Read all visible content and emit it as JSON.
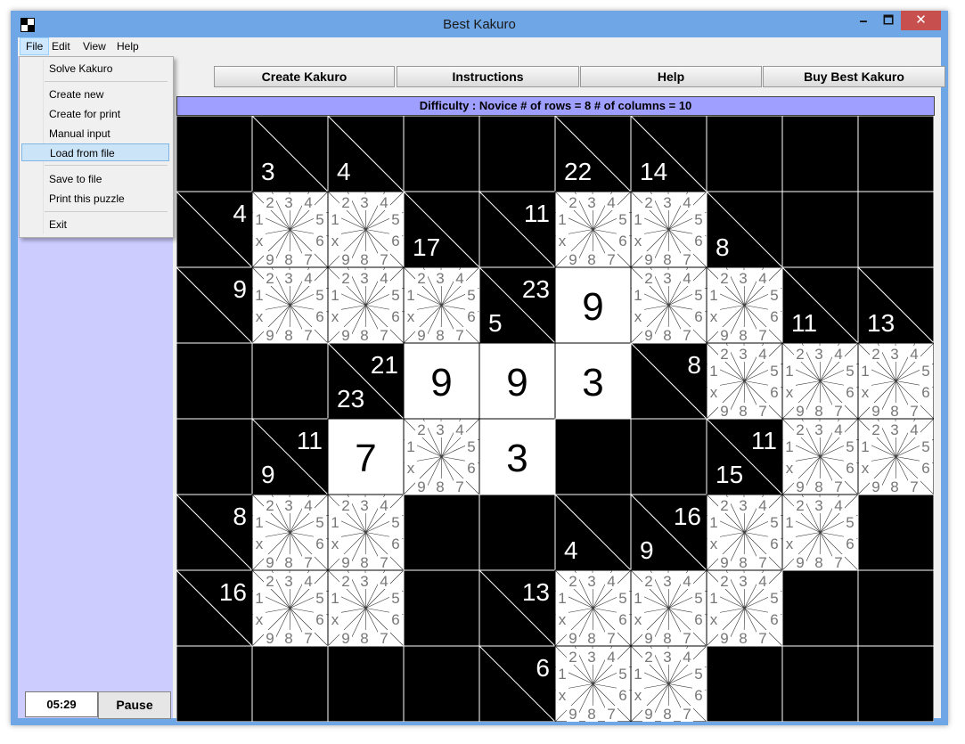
{
  "window": {
    "title": "Best Kakuro",
    "minimize": "🗕",
    "maximize": "🗖",
    "close": "✕"
  },
  "menubar": {
    "items": [
      "File",
      "Edit",
      "View",
      "Help"
    ]
  },
  "file_menu": {
    "items": [
      "Solve Kakuro",
      "Create new",
      "Create for print",
      "Manual input",
      "Load from file",
      "Save to file",
      "Print this puzzle",
      "Exit"
    ],
    "highlighted": "Load from file"
  },
  "toolbar": {
    "tabs": [
      "Create Kakuro",
      "Instructions",
      "Help",
      "Buy Best Kakuro"
    ]
  },
  "info": {
    "difficulty": "Difficulty : Novice    # of rows = 8    # of columns = 10"
  },
  "status": {
    "timer": "05:29",
    "pause_label": "Pause"
  },
  "board": {
    "rows": 8,
    "cols": 10,
    "note_digits": [
      "1",
      "2",
      "3",
      "4",
      "5",
      "6",
      "7",
      "8",
      "9",
      "x"
    ],
    "grid": [
      [
        "B",
        "C:3:",
        "C:4:",
        "B",
        "B",
        "C:22:",
        "C:14:",
        "B",
        "B",
        "B"
      ],
      [
        "C::4",
        "E",
        "E",
        "C:17:",
        "C::11",
        "E",
        "E",
        "C:8:",
        "B",
        "B"
      ],
      [
        "C::9",
        "E",
        "E",
        "E",
        "C:5:23",
        "V:9",
        "E",
        "E",
        "C:11:",
        "C:13:"
      ],
      [
        "B",
        "B",
        "C:23:21",
        "V:9",
        "V:9",
        "V:3",
        "C::8",
        "E",
        "E",
        "E"
      ],
      [
        "B",
        "C:9:11",
        "V:7",
        "E",
        "V:3",
        "B",
        "B",
        "C:15:11",
        "E",
        "E"
      ],
      [
        "C::8",
        "E",
        "E",
        "B",
        "B",
        "C:4:",
        "C:9:16",
        "E",
        "E",
        "B"
      ],
      [
        "C::16",
        "E",
        "E",
        "B",
        "C::13",
        "E",
        "E",
        "E",
        "B",
        "B"
      ],
      [
        "B",
        "B",
        "B",
        "B",
        "C::6",
        "E",
        "E",
        "B",
        "B",
        "B"
      ]
    ]
  }
}
